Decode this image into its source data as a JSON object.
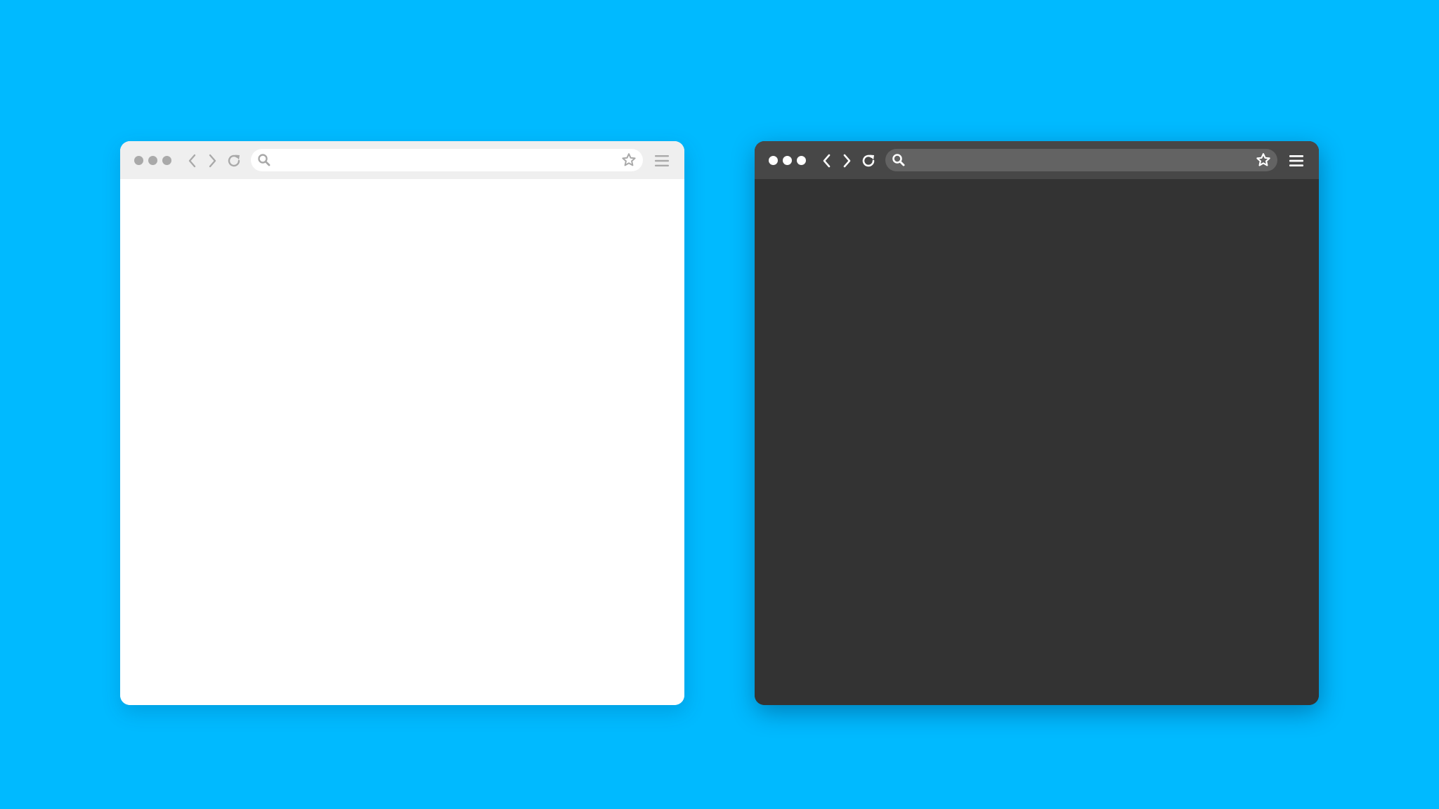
{
  "colors": {
    "background": "#00BAFF",
    "light_window_bg": "#FFFFFF",
    "light_toolbar_bg": "#EFEFEF",
    "light_address_bg": "#FFFFFF",
    "light_icon": "#A9A9A9",
    "dark_window_bg": "#333333",
    "dark_toolbar_bg": "#474747",
    "dark_address_bg": "#636363",
    "dark_icon": "#FFFFFF"
  },
  "windows": [
    {
      "theme": "light",
      "address_bar": {
        "value": "",
        "placeholder": ""
      },
      "icons": [
        "window-dot-icon",
        "back-icon",
        "forward-icon",
        "reload-icon",
        "search-icon",
        "star-icon",
        "hamburger-menu-icon"
      ]
    },
    {
      "theme": "dark",
      "address_bar": {
        "value": "",
        "placeholder": ""
      },
      "icons": [
        "window-dot-icon",
        "back-icon",
        "forward-icon",
        "reload-icon",
        "search-icon",
        "star-icon",
        "hamburger-menu-icon"
      ]
    }
  ]
}
